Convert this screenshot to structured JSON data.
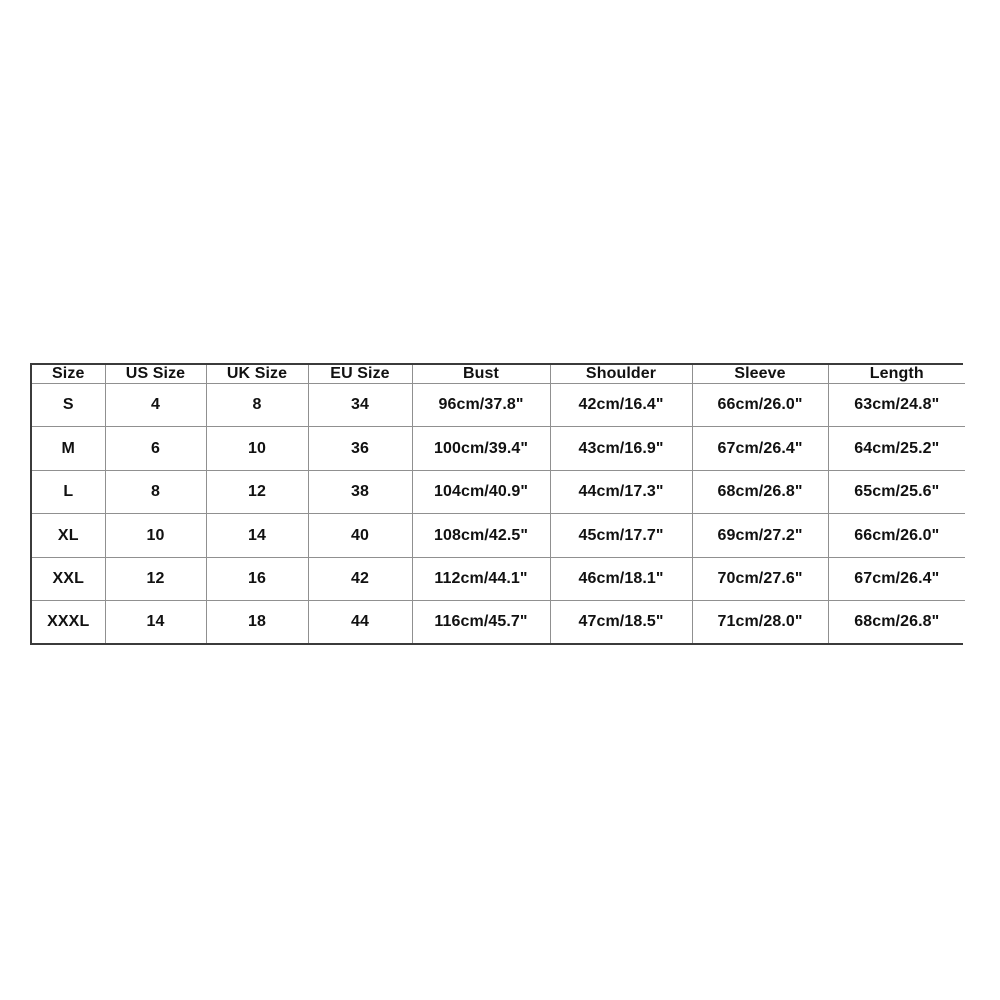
{
  "page": {
    "background_color": "#ffffff",
    "text_color": "#111111",
    "outer_border_color": "#3b3b3b",
    "inner_border_color": "#909090"
  },
  "size_chart": {
    "columns": [
      "Size",
      "US Size",
      "UK Size",
      "EU Size",
      "Bust",
      "Shoulder",
      "Sleeve",
      "Length"
    ],
    "rows": [
      {
        "size": "S",
        "us_size": "4",
        "uk_size": "8",
        "eu_size": "34",
        "bust": "96cm/37.8\"",
        "shoulder": "42cm/16.4\"",
        "sleeve": "66cm/26.0\"",
        "length": "63cm/24.8\""
      },
      {
        "size": "M",
        "us_size": "6",
        "uk_size": "10",
        "eu_size": "36",
        "bust": "100cm/39.4\"",
        "shoulder": "43cm/16.9\"",
        "sleeve": "67cm/26.4\"",
        "length": "64cm/25.2\""
      },
      {
        "size": "L",
        "us_size": "8",
        "uk_size": "12",
        "eu_size": "38",
        "bust": "104cm/40.9\"",
        "shoulder": "44cm/17.3\"",
        "sleeve": "68cm/26.8\"",
        "length": "65cm/25.6\""
      },
      {
        "size": "XL",
        "us_size": "10",
        "uk_size": "14",
        "eu_size": "40",
        "bust": "108cm/42.5\"",
        "shoulder": "45cm/17.7\"",
        "sleeve": "69cm/27.2\"",
        "length": "66cm/26.0\""
      },
      {
        "size": "XXL",
        "us_size": "12",
        "uk_size": "16",
        "eu_size": "42",
        "bust": "112cm/44.1\"",
        "shoulder": "46cm/18.1\"",
        "sleeve": "70cm/27.6\"",
        "length": "67cm/26.4\""
      },
      {
        "size": "XXXL",
        "us_size": "14",
        "uk_size": "18",
        "eu_size": "44",
        "bust": "116cm/45.7\"",
        "shoulder": "47cm/18.5\"",
        "sleeve": "71cm/28.0\"",
        "length": "68cm/26.8\""
      }
    ]
  }
}
